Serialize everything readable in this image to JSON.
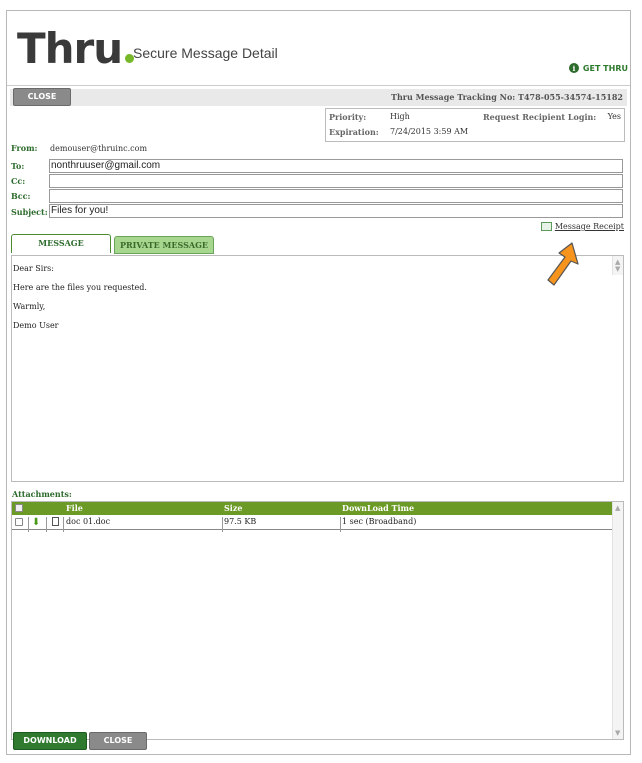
{
  "header": {
    "logo": "Thru",
    "title": "Secure Message Detail",
    "get_thru": "GET THRU"
  },
  "toolbar": {
    "close_label": "CLOSE",
    "tracking": "Thru Message Tracking No: T478-055-34574-15182"
  },
  "meta": {
    "priority_label": "Priority:",
    "priority_value": "High",
    "expiration_label": "Expiration:",
    "expiration_value": "7/24/2015 3:59 AM",
    "recipient_login_label": "Request Recipient Login:",
    "recipient_login_value": "Yes"
  },
  "fields": {
    "from_label": "From:",
    "from_value": "demouser@thruinc.com",
    "to_label": "To:",
    "to_value": "nonthruuser@gmail.com",
    "cc_label": "Cc:",
    "cc_value": "",
    "bcc_label": "Bcc:",
    "bcc_value": "",
    "subject_label": "Subject:",
    "subject_value": "Files for you!"
  },
  "receipt_link": "Message Receipt",
  "tabs": {
    "message": "MESSAGE",
    "private": "PRIVATE MESSAGE"
  },
  "message_lines": [
    "Dear Sirs:",
    "Here are the files  you requested.",
    "Warmly,",
    "Demo User"
  ],
  "attachments": {
    "label": "Attachments:",
    "columns": {
      "file": "File",
      "size": "Size",
      "download_time": "DownLoad Time"
    },
    "rows": [
      {
        "file": "doc 01.doc",
        "size": "97.5 KB",
        "download_time": "1 sec (Broadband)"
      }
    ]
  },
  "footer": {
    "download_label": "DOWNLOAD",
    "close_label": "CLOSE"
  },
  "colors": {
    "brand_green": "#76b82a",
    "header_green": "#6c9a26",
    "button_green": "#2f7a2f",
    "arrow_orange": "#f7941d"
  }
}
